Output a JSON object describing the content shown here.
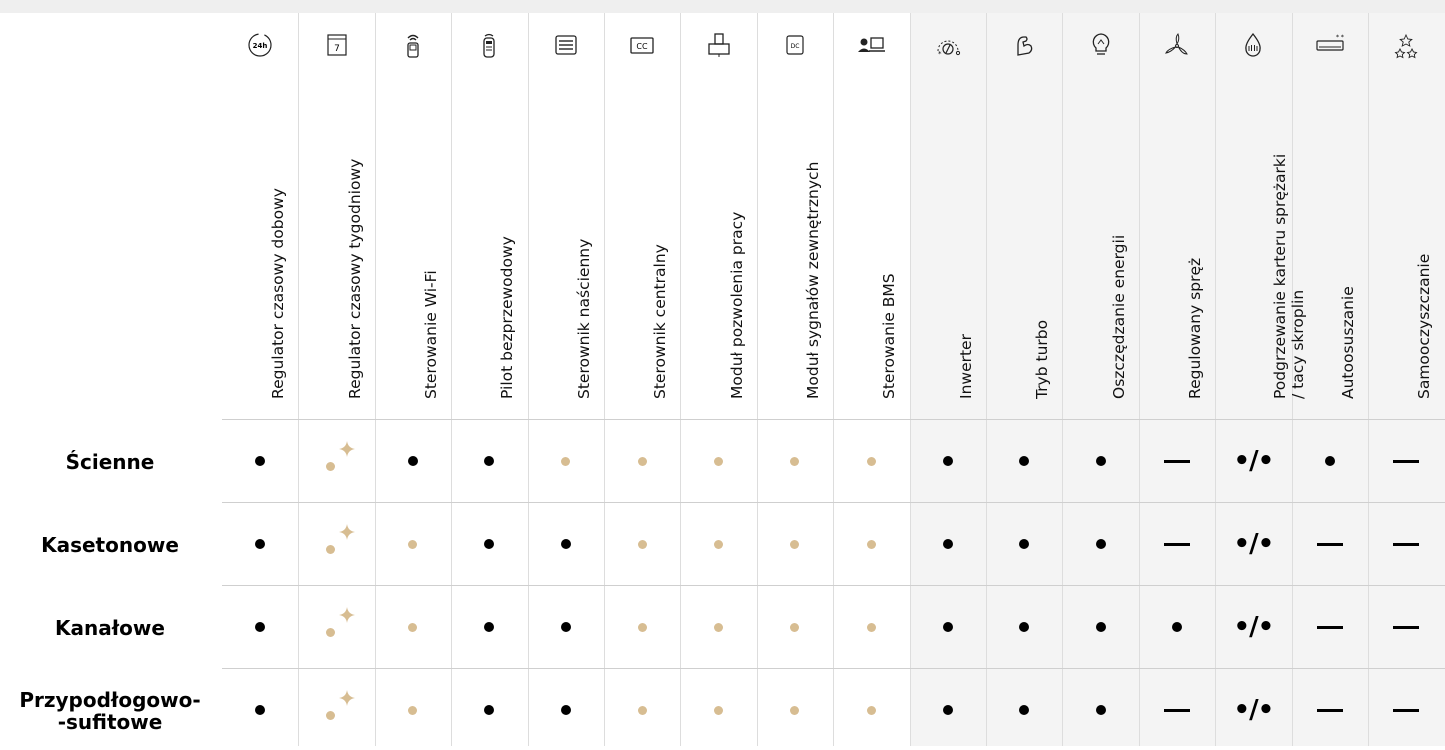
{
  "colors": {
    "black_dot": "#000000",
    "gold_dot": "#d7bd92",
    "shaded_column_bg": "#f4f4f4",
    "top_bar_bg": "#efefef"
  },
  "columns": [
    {
      "label": "Regulator czasowy dobowy",
      "icon": "24h-clock-icon",
      "icon_text": "24h",
      "shaded": false
    },
    {
      "label": "Regulator czasowy tygodniowy",
      "icon": "calendar-icon",
      "icon_text": "7",
      "shaded": false
    },
    {
      "label": "Sterowanie Wi-Fi",
      "icon": "wifi-remote-icon",
      "shaded": false
    },
    {
      "label": "Pilot bezprzewodowy",
      "icon": "remote-control-icon",
      "shaded": false
    },
    {
      "label": "Sterownik naścienny",
      "icon": "wall-controller-icon",
      "shaded": false
    },
    {
      "label": "Sterownik centralny",
      "icon": "central-controller-icon",
      "icon_text": "CC",
      "shaded": false
    },
    {
      "label": "Moduł pozwolenia pracy",
      "icon": "work-permit-module-icon",
      "shaded": false
    },
    {
      "label": "Moduł sygnałów zewnętrznych",
      "icon": "external-signal-module-icon",
      "icon_text": "DC",
      "shaded": false
    },
    {
      "label": "Sterowanie BMS",
      "icon": "bms-computer-icon",
      "shaded": false
    },
    {
      "label": "Inwerter",
      "icon": "inverter-dial-icon",
      "shaded": true
    },
    {
      "label": "Tryb turbo",
      "icon": "turbo-arm-icon",
      "shaded": true
    },
    {
      "label": "Oszczędzanie energii",
      "icon": "lightbulb-icon",
      "shaded": true
    },
    {
      "label": "Regulowany spręż",
      "icon": "fan-icon",
      "shaded": true
    },
    {
      "label": "Podgrzewanie karteru sprężarki\n/ tacy skroplin",
      "icon": "heating-drop-icon",
      "shaded": true
    },
    {
      "label": "Autoosuszanie",
      "icon": "air-conditioner-icon",
      "shaded": true
    },
    {
      "label": "Samooczyszczanie",
      "icon": "sparkle-stars-icon",
      "shaded": true
    }
  ],
  "rows": [
    {
      "label": "Ścienne",
      "cells": [
        "black",
        "gold-star",
        "black",
        "black",
        "gold",
        "gold",
        "gold",
        "gold",
        "gold",
        "black",
        "black",
        "black",
        "dash",
        "pair",
        "black",
        "dash"
      ]
    },
    {
      "label": "Kasetonowe",
      "cells": [
        "black",
        "gold-star",
        "gold",
        "black",
        "black",
        "gold",
        "gold",
        "gold",
        "gold",
        "black",
        "black",
        "black",
        "dash",
        "pair",
        "dash",
        "dash"
      ]
    },
    {
      "label": "Kanałowe",
      "cells": [
        "black",
        "gold-star",
        "gold",
        "black",
        "black",
        "gold",
        "gold",
        "gold",
        "gold",
        "black",
        "black",
        "black",
        "black",
        "pair",
        "dash",
        "dash"
      ]
    },
    {
      "label": "Przypodłogowo-\n-sufitowe",
      "cells": [
        "black",
        "gold-star",
        "gold",
        "black",
        "black",
        "gold",
        "gold",
        "gold",
        "gold",
        "black",
        "black",
        "black",
        "dash",
        "pair",
        "dash",
        "dash"
      ]
    }
  ],
  "pair_symbol": "•/•"
}
